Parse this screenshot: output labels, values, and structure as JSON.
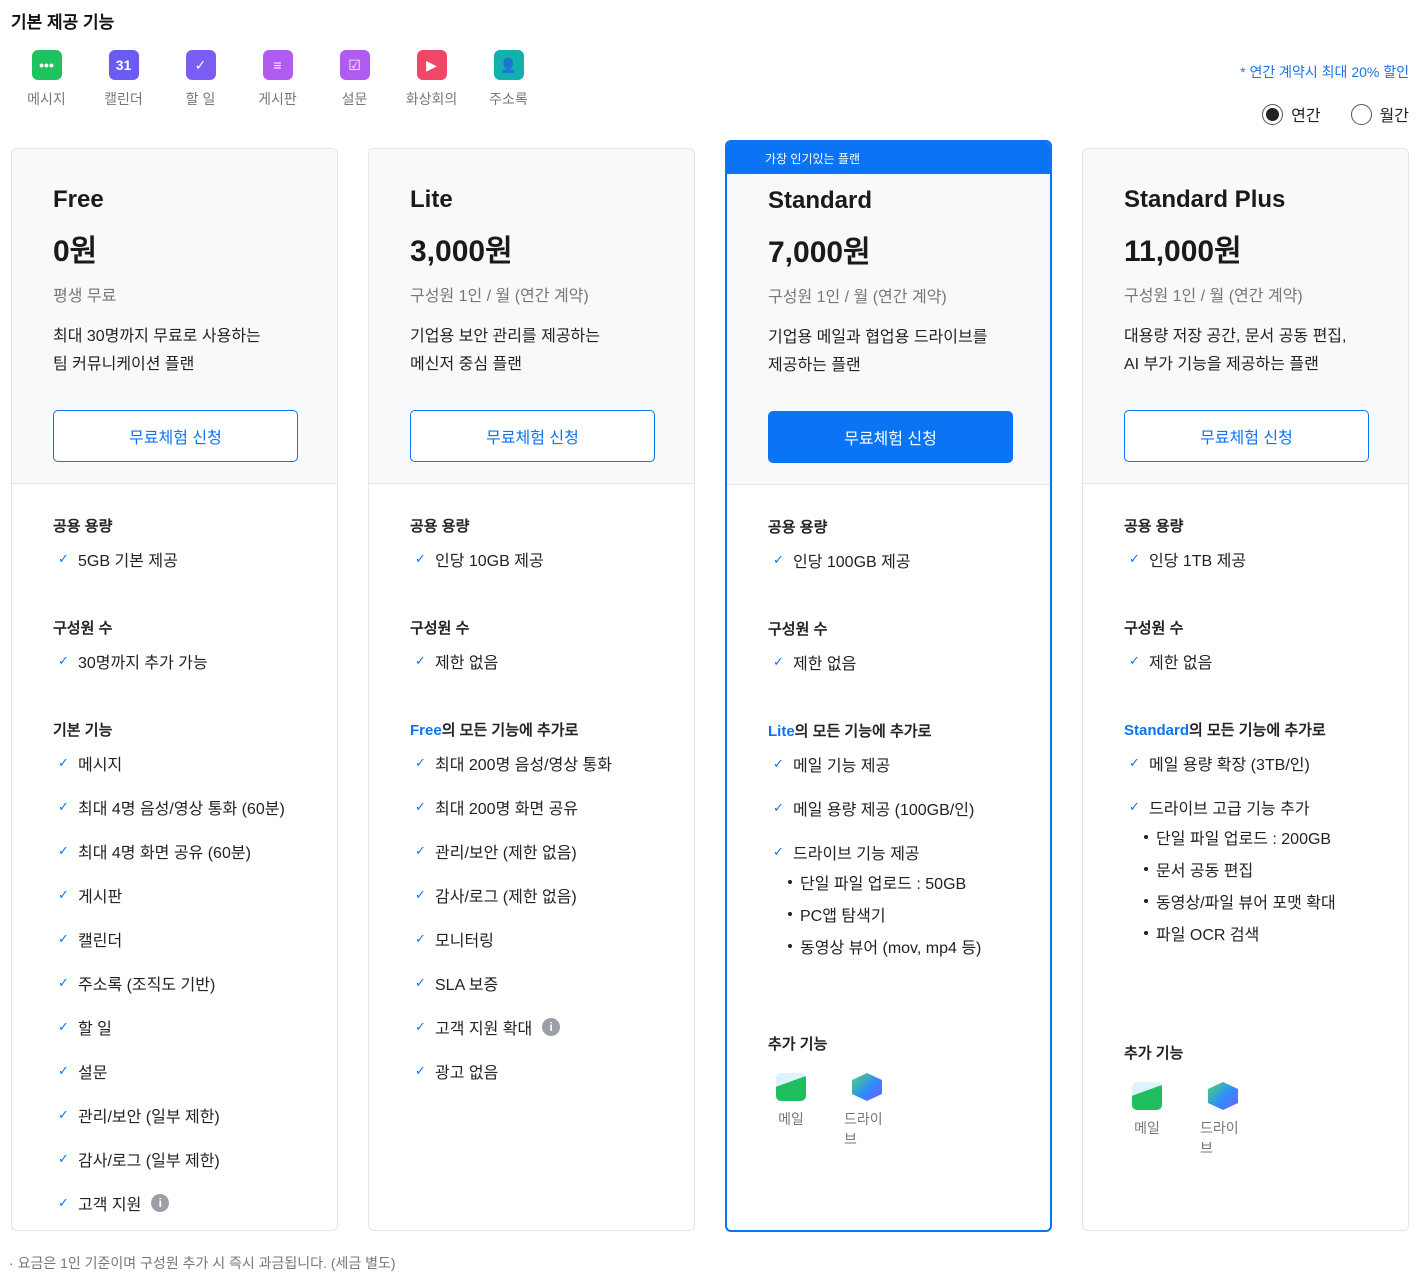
{
  "header": {
    "title": "기본 제공 기능",
    "discount_note": "* 연간 계약시 최대 20% 할인",
    "billing": {
      "annual": "연간",
      "monthly": "월간",
      "selected": "annual"
    }
  },
  "apps": [
    {
      "label": "메시지",
      "icon": "chat-icon",
      "color": "#1ec25f",
      "glyph": "•••"
    },
    {
      "label": "캘린더",
      "icon": "calendar-icon",
      "color": "#6a5cf0",
      "glyph": "31"
    },
    {
      "label": "할 일",
      "icon": "todo-check-icon",
      "color": "#7b5cf5",
      "glyph": "✓"
    },
    {
      "label": "게시판",
      "icon": "board-icon",
      "color": "#b15cf0",
      "glyph": "≡"
    },
    {
      "label": "설문",
      "icon": "survey-icon",
      "color": "#b15cf0",
      "glyph": "☑"
    },
    {
      "label": "화상회의",
      "icon": "video-icon",
      "color": "#f04668",
      "glyph": "▶"
    },
    {
      "label": "주소록",
      "icon": "contacts-icon",
      "color": "#13b1ad",
      "glyph": "👤"
    }
  ],
  "plans": [
    {
      "name": "Free",
      "price": "0원",
      "sub": "평생 무료",
      "desc1": "최대 30명까지 무료로 사용하는",
      "desc2": "팀 커뮤니케이션 플랜",
      "button": "무료체험 신청",
      "storage_h": "공용 용량",
      "storage": "5GB 기본 제공",
      "members_h": "구성원 수",
      "members": "30명까지 추가 가능",
      "features_h": "기본 기능",
      "features_prefix": "",
      "features": [
        "메시지",
        "최대 4명 음성/영상 통화 (60분)",
        "최대 4명 화면 공유 (60분)",
        "게시판",
        "캘린더",
        "주소록 (조직도 기반)",
        "할 일",
        "설문",
        "관리/보안 (일부 제한)",
        "감사/로그 (일부 제한)",
        "고객 지원"
      ]
    },
    {
      "name": "Lite",
      "price": "3,000원",
      "sub": "구성원 1인 / 월 (연간 계약)",
      "desc1": "기업용 보안 관리를 제공하는",
      "desc2": "메신저 중심 플랜",
      "button": "무료체험 신청",
      "storage_h": "공용 용량",
      "storage": "인당 10GB 제공",
      "members_h": "구성원 수",
      "members": "제한 없음",
      "features_prefix": "Free",
      "features_h": "의 모든 기능에 추가로",
      "features": [
        "최대 200명 음성/영상 통화",
        "최대 200명 화면 공유",
        "관리/보안 (제한 없음)",
        "감사/로그 (제한 없음)",
        "모니터링",
        "SLA 보증",
        "고객 지원 확대",
        "광고 없음"
      ]
    },
    {
      "badge": "가장 인기있는 플랜",
      "name": "Standard",
      "price": "7,000원",
      "sub": "구성원 1인 / 월 (연간 계약)",
      "desc1": "기업용 메일과 협업용 드라이브를",
      "desc2": "제공하는 플랜",
      "button": "무료체험 신청",
      "storage_h": "공용 용량",
      "storage": "인당 100GB 제공",
      "members_h": "구성원 수",
      "members": "제한 없음",
      "features_prefix": "Lite",
      "features_h": "의 모든 기능에 추가로",
      "features": [
        "메일 기능 제공",
        "메일 용량 제공 (100GB/인)",
        "드라이브 기능 제공"
      ],
      "sub_features": [
        "단일 파일 업로드 : 50GB",
        "PC앱 탐색기",
        "동영상 뷰어 (mov, mp4 등)"
      ],
      "addon_h": "추가 기능",
      "addons": [
        "메일",
        "드라이브"
      ]
    },
    {
      "name": "Standard Plus",
      "price": "11,000원",
      "sub": "구성원 1인 / 월 (연간 계약)",
      "desc1": "대용량 저장 공간, 문서 공동 편집,",
      "desc2": "AI 부가 기능을 제공하는 플랜",
      "button": "무료체험 신청",
      "storage_h": "공용 용량",
      "storage": "인당 1TB 제공",
      "members_h": "구성원 수",
      "members": "제한 없음",
      "features_prefix": "Standard",
      "features_h": "의 모든 기능에 추가로",
      "features": [
        "메일 용량 확장 (3TB/인)",
        "드라이브 고급 기능 추가"
      ],
      "sub_features": [
        "단일 파일 업로드 : 200GB",
        "문서 공동 편집",
        "동영상/파일 뷰어 포맷 확대",
        "파일 OCR 검색"
      ],
      "addon_h": "추가 기능",
      "addons": [
        "메일",
        "드라이브"
      ]
    }
  ],
  "footer": "요금은 1인 기준이며 구성원 추가 시 즉시 과금됩니다. (세금 별도)"
}
